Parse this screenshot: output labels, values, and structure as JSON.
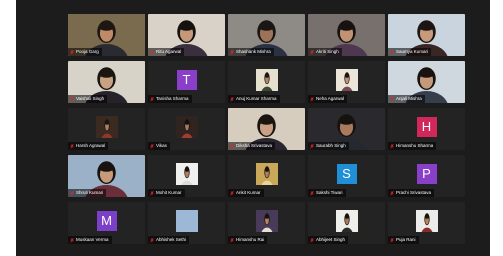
{
  "meeting": {
    "participants": [
      {
        "name": "Pooja Garg",
        "kind": "video",
        "bg": "#7a6a4e",
        "skin": "#c08a68",
        "hair": "#1d1712",
        "cloth": "#2a2a33",
        "active": true
      },
      {
        "name": "Ritu Agarwal",
        "kind": "video",
        "bg": "#d9d2c8",
        "skin": "#c6987a",
        "hair": "#15110f",
        "cloth": "#3a2f3c"
      },
      {
        "name": "Shashank Mishra",
        "kind": "video",
        "bg": "#8e8a86",
        "skin": "#9c7358",
        "hair": "#1b1613",
        "cloth": "#2b3140"
      },
      {
        "name": "Akriti Singh",
        "kind": "video",
        "bg": "#77706d",
        "skin": "#c29274",
        "hair": "#171210",
        "cloth": "#4d3850"
      },
      {
        "name": "Saumya Kumari",
        "kind": "video",
        "bg": "#c9d4df",
        "skin": "#c79a7c",
        "hair": "#1c1512",
        "cloth": "#3a2624"
      },
      {
        "name": "Vaishali Singh",
        "kind": "video",
        "bg": "#d8d3c9",
        "skin": "#c9a284",
        "hair": "#1b1512",
        "cloth": "#26212a"
      },
      {
        "name": "Tanisha Sharma",
        "kind": "letter",
        "letter": "T",
        "color": "#8a3fc9"
      },
      {
        "name": "Anuj Kumar Sharma",
        "kind": "photo",
        "bg": "#e6e0cf",
        "skin": "#b4845f",
        "hair": "#1d1713",
        "cloth": "#3a4a2e"
      },
      {
        "name": "Neha Agarwal",
        "kind": "photo",
        "bg": "#ece6da",
        "skin": "#c79473",
        "hair": "#1a1412",
        "cloth": "#7a4a52"
      },
      {
        "name": "Anjali Mishra",
        "kind": "video",
        "bg": "#cfd7df",
        "skin": "#c59a7a",
        "hair": "#181310",
        "cloth": "#363e4c"
      },
      {
        "name": "Harsh Agrawal",
        "kind": "photo",
        "bg": "#3a2a20",
        "skin": "#b27f5c",
        "hair": "#1b1512",
        "cloth": "#8a3a2a"
      },
      {
        "name": "Vikas",
        "kind": "photo",
        "bg": "#2f2420",
        "skin": "#a97a5a",
        "hair": "#151110",
        "cloth": "#a23c2e"
      },
      {
        "name": "Diksha Srivastava",
        "kind": "video",
        "bg": "#d6cdbf",
        "skin": "#caa084",
        "hair": "#1a1411",
        "cloth": "#2a2630"
      },
      {
        "name": "Saurabh Singh",
        "kind": "video",
        "bg": "#2a2a2e",
        "skin": "#a97b5c",
        "hair": "#161210",
        "cloth": "#25282e"
      },
      {
        "name": "Himanshu Sharma",
        "kind": "letter",
        "letter": "H",
        "color": "#d1275a"
      },
      {
        "name": "Shruti Kumari",
        "kind": "video",
        "bg": "#9ab1c8",
        "skin": "#c79a7a",
        "hair": "#17120f",
        "cloth": "#6a2f3a"
      },
      {
        "name": "Mohit Kumar",
        "kind": "photo",
        "bg": "#f0f0ee",
        "skin": "#b08060",
        "hair": "#181311",
        "cloth": "#dcdcdc"
      },
      {
        "name": "Ankit Kumar",
        "kind": "photo",
        "bg": "#caa85a",
        "skin": "#b07d5a",
        "hair": "#1a1411",
        "cloth": "#e8d59a"
      },
      {
        "name": "Sakshi Tiwari",
        "kind": "letter",
        "letter": "S",
        "color": "#1f8fd8"
      },
      {
        "name": "Prachi Srivastava",
        "kind": "letter",
        "letter": "P",
        "color": "#8a3fc9"
      },
      {
        "name": "Muskaan Verma",
        "kind": "letter",
        "letter": "M",
        "color": "#7b3fc9"
      },
      {
        "name": "Abhishek Sethi",
        "kind": "photo",
        "bg": "#9db7d6",
        "skin": "#9db7d6",
        "hair": "#9db7d6",
        "cloth": "#9db7d6"
      },
      {
        "name": "Himanshu Rai",
        "kind": "photo",
        "bg": "#4a3a5a",
        "skin": "#b3845f",
        "hair": "#161211",
        "cloth": "#e8e0d0"
      },
      {
        "name": "Abhijeet Singh",
        "kind": "photo",
        "bg": "#eeeeea",
        "skin": "#a87a58",
        "hair": "#181311",
        "cloth": "#2a2a2a"
      },
      {
        "name": "Puja Rani",
        "kind": "photo",
        "bg": "#ececea",
        "skin": "#b3845f",
        "hair": "#181311",
        "cloth": "#8a2a2a"
      }
    ],
    "icons": {
      "muted": "mic-off-icon"
    },
    "colors": {
      "muted_icon": "#e0262a",
      "active_speaker": "#d6e63a",
      "stage_bg": "#1c1c1c"
    }
  }
}
